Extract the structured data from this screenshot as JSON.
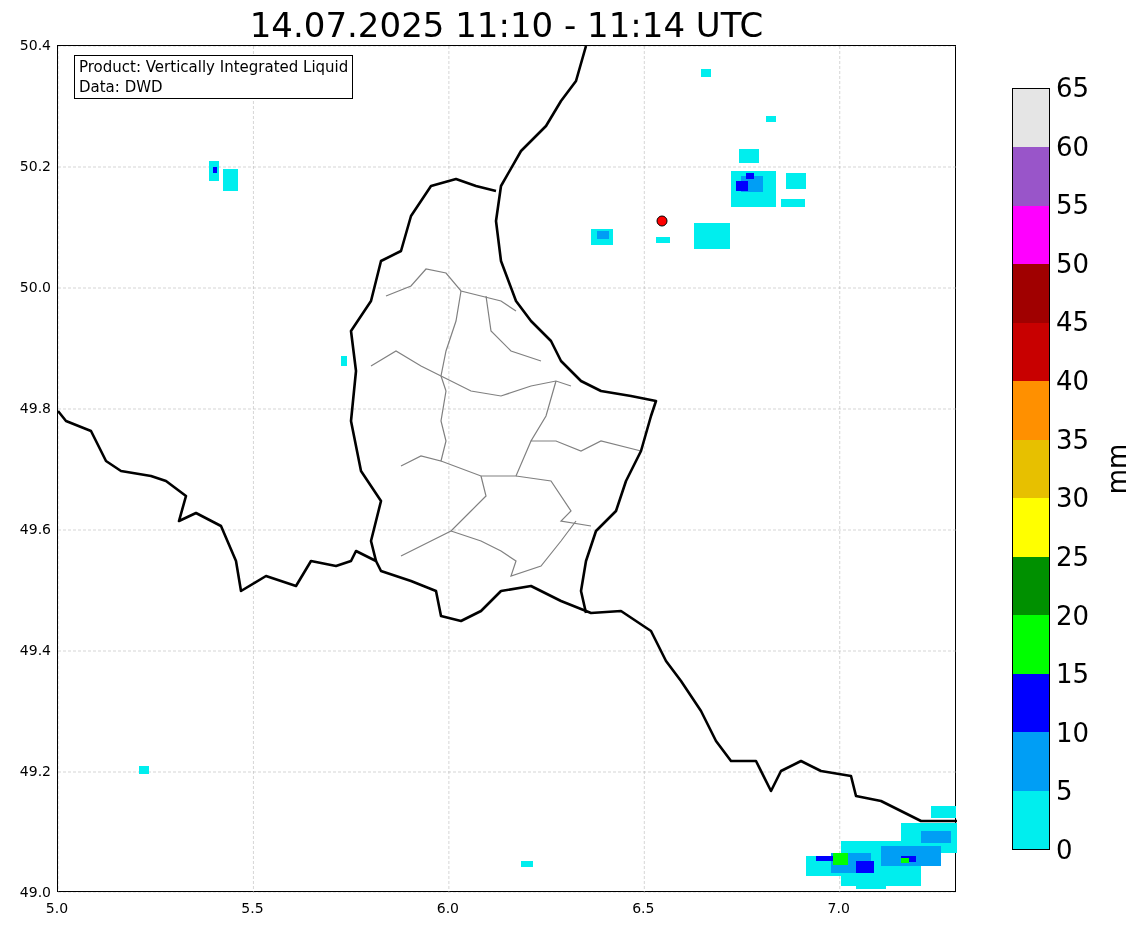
{
  "title": "14.07.2025 11:10 - 11:14 UTC",
  "info_box": [
    "Product: Vertically Integrated Liquid",
    "Data: DWD"
  ],
  "x_ticks": [
    "5.0",
    "5.5",
    "6.0",
    "6.5",
    "7.0"
  ],
  "y_ticks": [
    "50.4",
    "50.2",
    "50.0",
    "49.8",
    "49.6",
    "49.4",
    "49.2",
    "49.0"
  ],
  "colorbar": {
    "label": "mm",
    "ticks": [
      "65",
      "60",
      "55",
      "50",
      "45",
      "40",
      "35",
      "30",
      "25",
      "20",
      "15",
      "10",
      "5",
      "0"
    ],
    "bands": [
      {
        "color": "#e5e5e5"
      },
      {
        "color": "#9955c9"
      },
      {
        "color": "#ff00ff"
      },
      {
        "color": "#a00000"
      },
      {
        "color": "#c80000"
      },
      {
        "color": "#ff9000"
      },
      {
        "color": "#e7c000"
      },
      {
        "color": "#ffff00"
      },
      {
        "color": "#009000"
      },
      {
        "color": "#00ff00"
      },
      {
        "color": "#0000ff"
      },
      {
        "color": "#009ef5"
      },
      {
        "color": "#00eeee"
      }
    ]
  }
}
